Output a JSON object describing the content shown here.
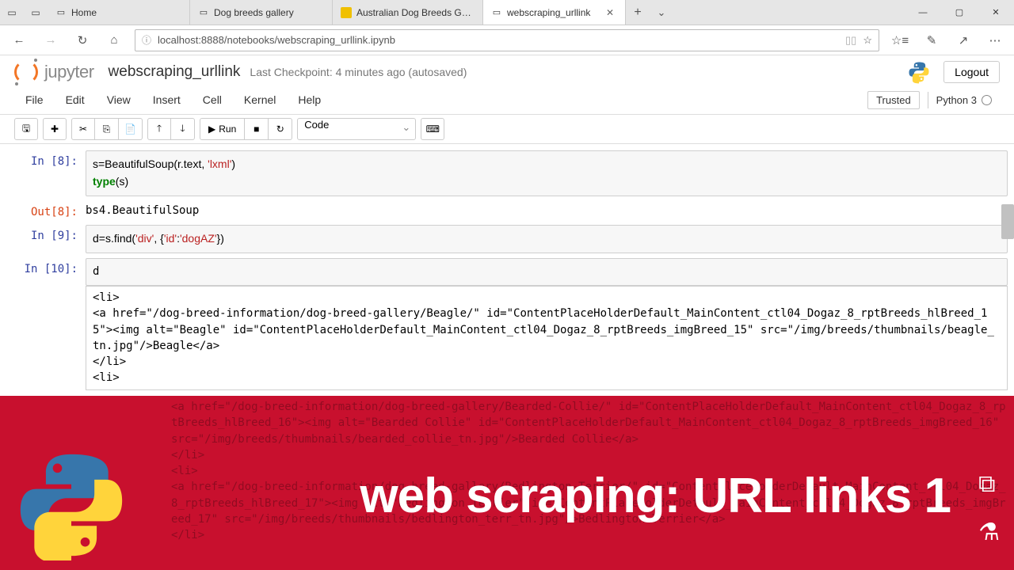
{
  "browser": {
    "tabs": [
      {
        "label": "Home"
      },
      {
        "label": "Dog breeds gallery"
      },
      {
        "label": "Australian Dog Breeds Galle"
      },
      {
        "label": "webscraping_urllink"
      }
    ],
    "url": "localhost:8888/notebooks/webscraping_urllink.ipynb"
  },
  "jupyter": {
    "brand": "jupyter",
    "title": "webscraping_urllink",
    "checkpoint": "Last Checkpoint: 4 minutes ago  (autosaved)",
    "logout": "Logout",
    "menus": [
      "File",
      "Edit",
      "View",
      "Insert",
      "Cell",
      "Kernel",
      "Help"
    ],
    "trusted": "Trusted",
    "kernel": "Python 3",
    "run": "Run",
    "celltype": "Code"
  },
  "cells": {
    "p8": "In [8]:",
    "c8a": "s=BeautifulSoup(r.text, ",
    "c8b": "'lxml'",
    "c8c": ")",
    "c8d": "type",
    "c8e": "(s)",
    "o8p": "Out[8]:",
    "o8": "bs4.BeautifulSoup",
    "p9": "In [9]:",
    "c9a": "d=s.find(",
    "c9b": "'div'",
    "c9c": ", {",
    "c9d": "'id'",
    "c9e": ":",
    "c9f": "'dogAZ'",
    "c9g": "})",
    "p10": "In [10]:",
    "c10": "d",
    "out10a": "<li>\n<a href=\"/dog-breed-information/dog-breed-gallery/Beagle/\" id=\"ContentPlaceHolderDefault_MainContent_ctl04_Dogaz_8_rptBreeds_hlBreed_15\"><img alt=\"Beagle\" id=\"ContentPlaceHolderDefault_MainContent_ctl04_Dogaz_8_rptBreeds_imgBreed_15\" src=\"/img/breeds/thumbnails/beagle_tn.jpg\"/>Beagle</a>\n</li>\n<li>",
    "out10b": "<a href=\"/dog-breed-information/dog-breed-gallery/Bearded-Collie/\" id=\"ContentPlaceHolderDefault_MainContent_ctl04_Dogaz_8_rptBreeds_hlBreed_16\"><img alt=\"Bearded Collie\" id=\"ContentPlaceHolderDefault_MainContent_ctl04_Dogaz_8_rptBreeds_imgBreed_16\" src=\"/img/breeds/thumbnails/bearded_collie_tn.jpg\"/>Bearded Collie</a>\n</li>\n<li>\n<a href=\"/dog-breed-information/dog-breed-gallery/Bedlington-Terrier/\" id=\"ContentPlaceHolderDefault_MainContent_ctl04_Dogaz_8_rptBreeds_hlBreed_17\"><img alt=\"Bedlington Terrier\" id=\"ContentPlaceHolderDefault_MainContent_ctl04_Dogaz_8_rptBreeds_imgBreed_17\" src=\"/img/breeds/thumbnails/bedlington_terr_tn.jpg\"/>Bedlington Terrier</a>\n</li>"
  },
  "overlay": {
    "title": "web scraping: URL links 1"
  }
}
